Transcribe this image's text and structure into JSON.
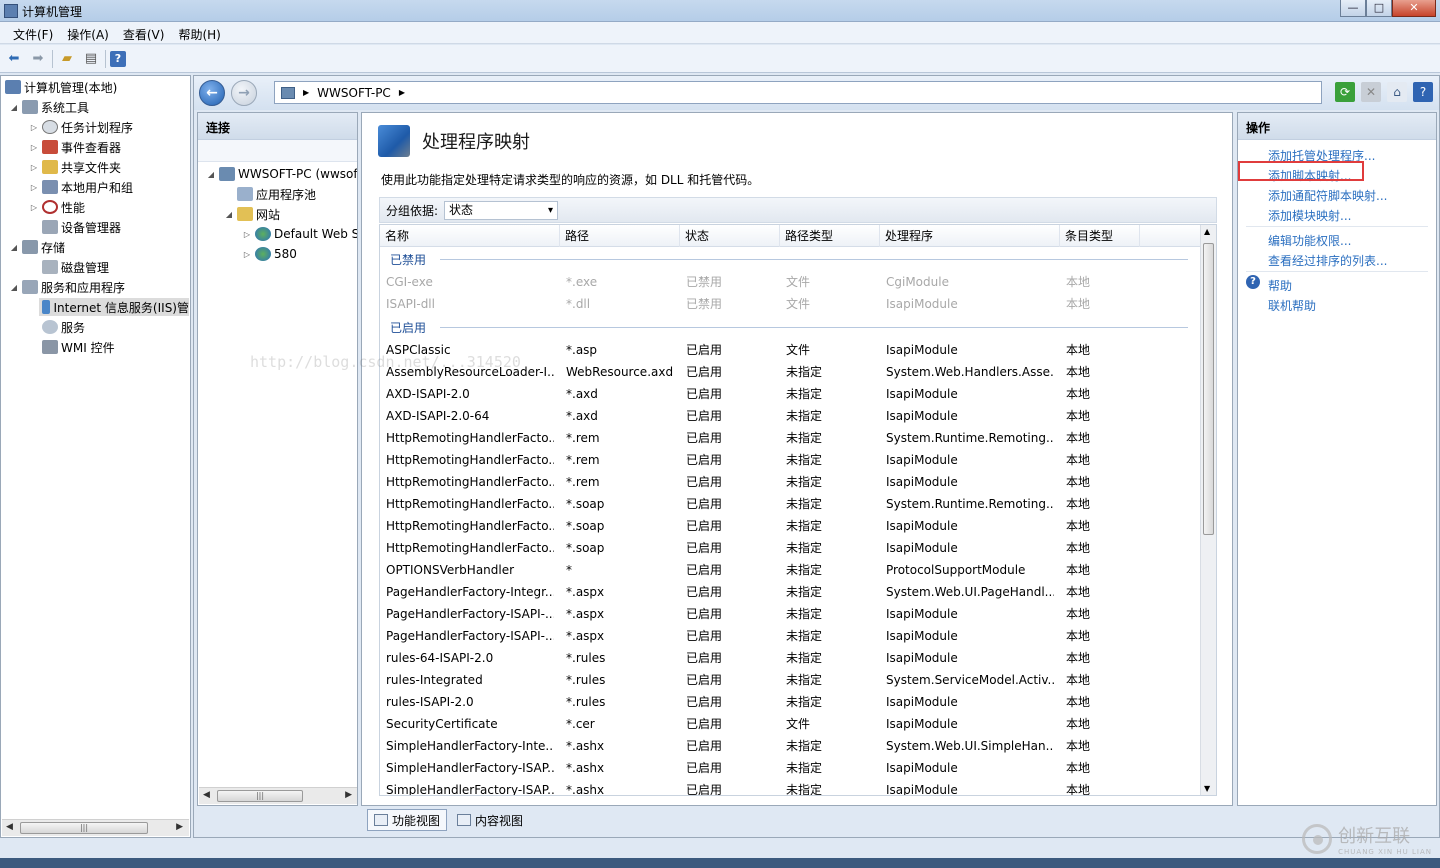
{
  "window": {
    "title": "计算机管理",
    "buttons": [
      "—",
      "□",
      "✕"
    ]
  },
  "menu": [
    "文件(F)",
    "操作(A)",
    "查看(V)",
    "帮助(H)"
  ],
  "toolbar_icons": [
    "back-arrow-icon",
    "forward-arrow-icon",
    "up-folder-icon",
    "show-hide-tree-icon",
    "help-icon"
  ],
  "left_tree": {
    "root": "计算机管理(本地)",
    "items": [
      {
        "label": "系统工具",
        "level": 1,
        "icon": "tools-icon"
      },
      {
        "label": "任务计划程序",
        "level": 2,
        "icon": "clock-icon"
      },
      {
        "label": "事件查看器",
        "level": 2,
        "icon": "event-viewer-icon"
      },
      {
        "label": "共享文件夹",
        "level": 2,
        "icon": "shared-folder-icon"
      },
      {
        "label": "本地用户和组",
        "level": 2,
        "icon": "users-icon"
      },
      {
        "label": "性能",
        "level": 2,
        "icon": "performance-icon"
      },
      {
        "label": "设备管理器",
        "level": 2,
        "icon": "device-manager-icon"
      },
      {
        "label": "存储",
        "level": 1,
        "icon": "storage-icon"
      },
      {
        "label": "磁盘管理",
        "level": 2,
        "icon": "disk-icon"
      },
      {
        "label": "服务和应用程序",
        "level": 1,
        "icon": "services-apps-icon"
      },
      {
        "label": "Internet 信息服务(IIS)管",
        "level": 2,
        "icon": "iis-icon",
        "selected": true
      },
      {
        "label": "服务",
        "level": 2,
        "icon": "gear-icon"
      },
      {
        "label": "WMI 控件",
        "level": 2,
        "icon": "wmi-icon"
      }
    ]
  },
  "address": {
    "segments": [
      "WWSOFT-PC"
    ]
  },
  "connections": {
    "header": "连接",
    "items": [
      {
        "label": "WWSOFT-PC (wwsoft",
        "level": 0
      },
      {
        "label": "应用程序池",
        "level": 1
      },
      {
        "label": "网站",
        "level": 1
      },
      {
        "label": "Default Web S",
        "level": 2
      },
      {
        "label": "580",
        "level": 2
      }
    ]
  },
  "feature": {
    "title": "处理程序映射",
    "description": "使用此功能指定处理特定请求类型的响应的资源，如 DLL 和托管代码。",
    "group_by_label": "分组依据:",
    "group_by_value": "状态",
    "columns": [
      "名称",
      "路径",
      "状态",
      "路径类型",
      "处理程序",
      "条目类型"
    ],
    "disabled_group": "已禁用",
    "enabled_group": "已启用",
    "disabled_rows": [
      [
        "CGI-exe",
        "*.exe",
        "已禁用",
        "文件",
        "CgiModule",
        "本地"
      ],
      [
        "ISAPI-dll",
        "*.dll",
        "已禁用",
        "文件",
        "IsapiModule",
        "本地"
      ]
    ],
    "enabled_rows": [
      [
        "ASPClassic",
        "*.asp",
        "已启用",
        "文件",
        "IsapiModule",
        "本地"
      ],
      [
        "AssemblyResourceLoader-I...",
        "WebResource.axd",
        "已启用",
        "未指定",
        "System.Web.Handlers.Asse...",
        "本地"
      ],
      [
        "AXD-ISAPI-2.0",
        "*.axd",
        "已启用",
        "未指定",
        "IsapiModule",
        "本地"
      ],
      [
        "AXD-ISAPI-2.0-64",
        "*.axd",
        "已启用",
        "未指定",
        "IsapiModule",
        "本地"
      ],
      [
        "HttpRemotingHandlerFacto...",
        "*.rem",
        "已启用",
        "未指定",
        "System.Runtime.Remoting....",
        "本地"
      ],
      [
        "HttpRemotingHandlerFacto...",
        "*.rem",
        "已启用",
        "未指定",
        "IsapiModule",
        "本地"
      ],
      [
        "HttpRemotingHandlerFacto...",
        "*.rem",
        "已启用",
        "未指定",
        "IsapiModule",
        "本地"
      ],
      [
        "HttpRemotingHandlerFacto...",
        "*.soap",
        "已启用",
        "未指定",
        "System.Runtime.Remoting....",
        "本地"
      ],
      [
        "HttpRemotingHandlerFacto...",
        "*.soap",
        "已启用",
        "未指定",
        "IsapiModule",
        "本地"
      ],
      [
        "HttpRemotingHandlerFacto...",
        "*.soap",
        "已启用",
        "未指定",
        "IsapiModule",
        "本地"
      ],
      [
        "OPTIONSVerbHandler",
        "*",
        "已启用",
        "未指定",
        "ProtocolSupportModule",
        "本地"
      ],
      [
        "PageHandlerFactory-Integr...",
        "*.aspx",
        "已启用",
        "未指定",
        "System.Web.UI.PageHandl...",
        "本地"
      ],
      [
        "PageHandlerFactory-ISAPI-...",
        "*.aspx",
        "已启用",
        "未指定",
        "IsapiModule",
        "本地"
      ],
      [
        "PageHandlerFactory-ISAPI-...",
        "*.aspx",
        "已启用",
        "未指定",
        "IsapiModule",
        "本地"
      ],
      [
        "rules-64-ISAPI-2.0",
        "*.rules",
        "已启用",
        "未指定",
        "IsapiModule",
        "本地"
      ],
      [
        "rules-Integrated",
        "*.rules",
        "已启用",
        "未指定",
        "System.ServiceModel.Activ...",
        "本地"
      ],
      [
        "rules-ISAPI-2.0",
        "*.rules",
        "已启用",
        "未指定",
        "IsapiModule",
        "本地"
      ],
      [
        "SecurityCertificate",
        "*.cer",
        "已启用",
        "文件",
        "IsapiModule",
        "本地"
      ],
      [
        "SimpleHandlerFactory-Inte...",
        "*.ashx",
        "已启用",
        "未指定",
        "System.Web.UI.SimpleHan...",
        "本地"
      ],
      [
        "SimpleHandlerFactory-ISAP...",
        "*.ashx",
        "已启用",
        "未指定",
        "IsapiModule",
        "本地"
      ],
      [
        "SimpleHandlerFactory-ISAP...",
        "*.ashx",
        "已启用",
        "未指定",
        "IsapiModule",
        "本地"
      ]
    ],
    "view_tabs": [
      "功能视图",
      "内容视图"
    ]
  },
  "actions": {
    "header": "操作",
    "items": [
      "添加托管处理程序...",
      "添加脚本映射...",
      "添加通配符脚本映射...",
      "添加模块映射...",
      "编辑功能权限...",
      "查看经过排序的列表...",
      "帮助",
      "联机帮助"
    ],
    "highlighted": "添加脚本映射..."
  },
  "watermark": "http://blog.csdn.net/...314520",
  "logo": {
    "name": "创新互联",
    "sub": "CHUANG XIN HU LIAN"
  },
  "colors": {
    "link": "#2b6fc0",
    "highlight_box": "#e03c3c",
    "group_header": "#1f4f97"
  }
}
